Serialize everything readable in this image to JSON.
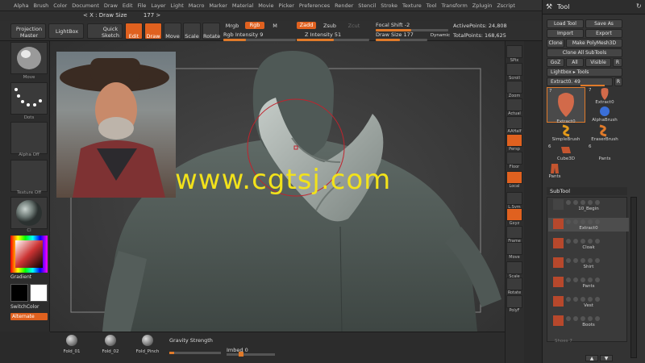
{
  "menu": [
    "Alpha",
    "Brush",
    "Color",
    "Document",
    "Draw",
    "Edit",
    "File",
    "Layer",
    "Light",
    "Macro",
    "Marker",
    "Material",
    "Movie",
    "Picker",
    "Preferences",
    "Render",
    "Stencil",
    "Stroke",
    "Texture",
    "Tool",
    "Transform",
    "Zplugin",
    "Zscript"
  ],
  "info": {
    "draw_size": "< X : Draw Size",
    "draw_size_value": "177 >"
  },
  "toolbar": {
    "projection_master": "Projection Master",
    "lightbox": "LightBox",
    "quick_sketch": "Quick Sketch",
    "edit": "Edit",
    "draw": "Draw",
    "move": "Move",
    "scale": "Scale",
    "rotate": "Rotate",
    "mrgb": "Mrgb",
    "rgb": "Rgb",
    "m": "M",
    "zadd": "Zadd",
    "zsub": "Zsub",
    "zcut": "Zcut",
    "rgb_intensity": "Rgb Intensity 9",
    "z_intensity": "Z Intensity 51",
    "focal_shift": "Focal Shift -2",
    "draw_size": "Draw Size 177",
    "dynamic": "Dynamic",
    "active_points": "ActivePoints: 24,808",
    "total_points": "TotalPoints: 168,625"
  },
  "left_shelf": {
    "brush_caption": "Move",
    "stroke_caption": "Dots",
    "alpha_caption": "Alpha Off",
    "texture_caption": "Texture Off",
    "material_caption": "Cl",
    "gradient": "Gradient",
    "switch_color": "SwitchColor",
    "alternate": "Alternate"
  },
  "watermark": "www.cgtsj.com",
  "right_bar": [
    "SPix",
    "Scroll",
    "Zoom",
    "Actual",
    "AAHalf",
    "Persp",
    "Floor",
    "Local",
    "L.Sym",
    "Gxyz",
    "Frame",
    "Move",
    "Scale",
    "Rotate",
    "PolyF"
  ],
  "tool_panel": {
    "title": "Tool",
    "load_tool": "Load Tool",
    "save_as": "Save As",
    "import": "Import",
    "export": "Export",
    "clone": "Clone",
    "make_polymesh": "Make PolyMesh3D",
    "clone_all": "Clone All SubTools",
    "goz": "GoZ",
    "all": "All",
    "visible": "Visible",
    "r": "R",
    "lightbox_tools": "Lightbox ▸ Tools",
    "extract_label": "Extract0. 49",
    "tool_count_main": "7",
    "tool_count_b": "7",
    "tool_count_c": "6",
    "tool_count_d": "6",
    "tools": [
      "Extract0",
      "Extract0",
      "AlphaBrush",
      "SimpleBrush",
      "EraserBrush",
      "Cube3D",
      "Pants",
      "Pants"
    ],
    "subtool_title": "SubTool",
    "subtools": [
      "10_Begin",
      "Extract0",
      "Cloak",
      "Shirt",
      "Pants",
      "Vest",
      "Boots"
    ],
    "subtool_footer": "Shoes 7"
  },
  "bottom": {
    "brushes": [
      "Fold_01",
      "Fold_02",
      "Fold_Pinch"
    ],
    "gravity_strength": "Gravity Strength",
    "imbed": "Imbed 0"
  },
  "colors": {
    "accent": "#e0611f",
    "panel": "#333333",
    "watermark": "#f2e21b"
  }
}
